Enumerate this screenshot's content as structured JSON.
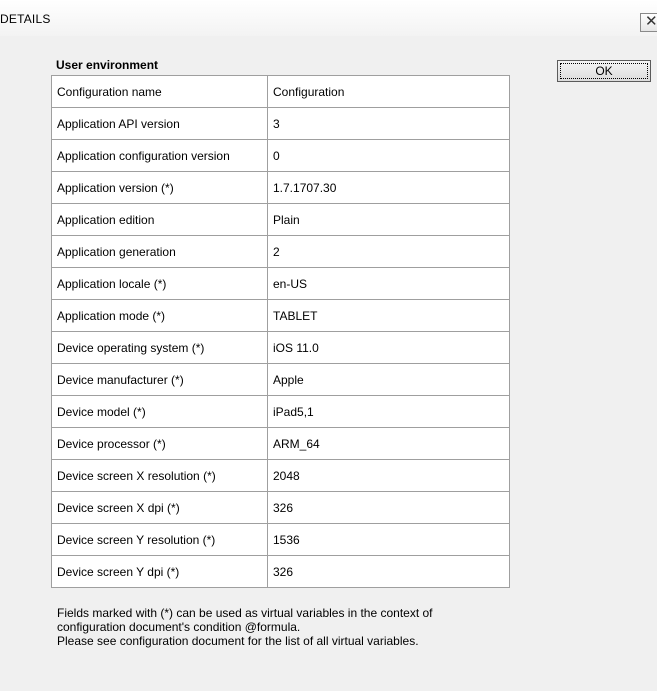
{
  "window": {
    "title": "DETAILS",
    "close_glyph": "✕"
  },
  "section": {
    "title": "User environment"
  },
  "ok_button": {
    "label": "OK"
  },
  "rows": [
    {
      "name": "Configuration name",
      "value": "Configuration"
    },
    {
      "name": "Application API version",
      "value": "3"
    },
    {
      "name": "Application configuration version",
      "value": "0"
    },
    {
      "name": "Application version (*)",
      "value": "1.7.1707.30"
    },
    {
      "name": "Application edition",
      "value": "Plain"
    },
    {
      "name": "Application generation",
      "value": "2"
    },
    {
      "name": "Application locale (*)",
      "value": "en-US"
    },
    {
      "name": "Application mode (*)",
      "value": "TABLET"
    },
    {
      "name": "Device operating system (*)",
      "value": "iOS 11.0"
    },
    {
      "name": "Device manufacturer (*)",
      "value": "Apple"
    },
    {
      "name": "Device model (*)",
      "value": "iPad5,1"
    },
    {
      "name": "Device processor (*)",
      "value": "ARM_64"
    },
    {
      "name": "Device screen X resolution (*)",
      "value": "2048"
    },
    {
      "name": "Device screen X dpi (*)",
      "value": "326"
    },
    {
      "name": "Device screen Y resolution (*)",
      "value": "1536"
    },
    {
      "name": "Device screen Y dpi (*)",
      "value": "326"
    }
  ],
  "footer": {
    "line1": "Fields marked with (*) can be used as virtual variables in the context of",
    "line2": "configuration document's condition @formula.",
    "line3": "Please see configuration document for the list of all virtual variables."
  }
}
